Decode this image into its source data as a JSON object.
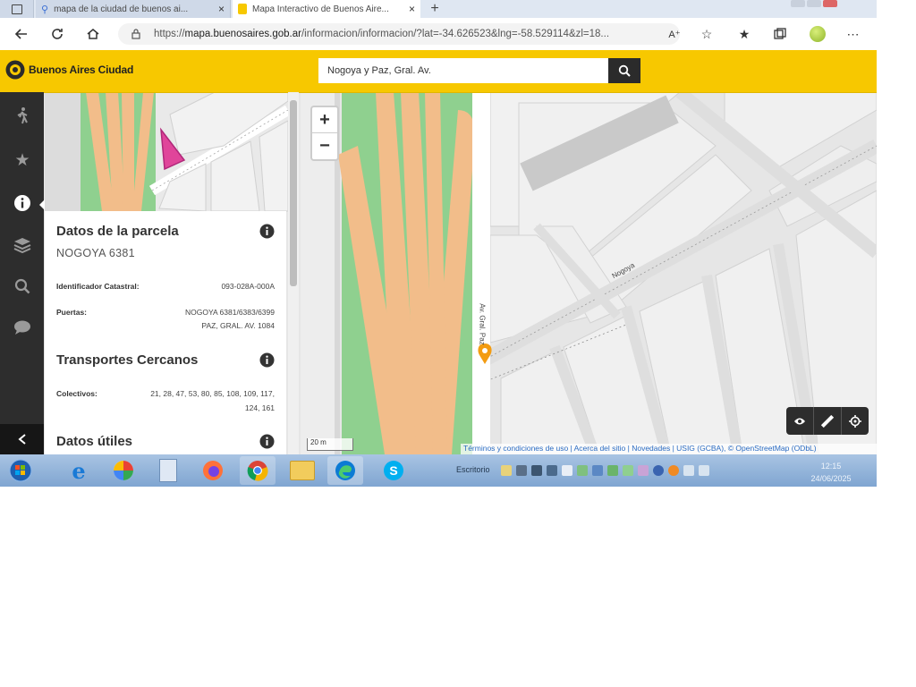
{
  "browser": {
    "tabs": [
      {
        "title": "mapa de la ciudad de buenos ai...",
        "active": false
      },
      {
        "title": "Mapa Interactivo de Buenos Aire...",
        "active": true
      }
    ],
    "url": {
      "prefix": "https://",
      "domain": "mapa.buenosaires.gob.ar",
      "path": "/informacion/informacion/?lat=-34.626523&lng=-58.529114&zl=18..."
    }
  },
  "site": {
    "brand": "Buenos Aires Ciudad",
    "search_value": "Nogoya y Paz, Gral. Av."
  },
  "panel": {
    "parcela": {
      "title": "Datos de la parcela",
      "subtitle": "NOGOYA 6381",
      "id_label": "Identificador Catastral:",
      "id_value": "093-028A-000A",
      "puertas_label": "Puertas:",
      "puertas_line1": "NOGOYA 6381/6383/6399",
      "puertas_line2": "PAZ, GRAL. AV. 1084"
    },
    "transportes": {
      "title": "Transportes Cercanos",
      "colectivos_label": "Colectivos:",
      "colectivos_line1": "21, 28, 47, 53, 80, 85, 108, 109, 117,",
      "colectivos_line2": "124, 161"
    },
    "utiles": {
      "title": "Datos útiles"
    }
  },
  "map": {
    "zoom_in": "+",
    "zoom_out": "−",
    "scale": "20 m",
    "attribution": "Términos y condiciones de uso | Acerca del sitio | Novedades | USIG (GCBA), © OpenStreetMap (ODbL)",
    "street_labels": {
      "nogoya": "Nogoya",
      "paz": "Av. Gral. Paz"
    },
    "colors": {
      "highway": "#f2bd8a",
      "green": "#8cd08e",
      "block": "#f2f2f2",
      "road": "#dcdcdc",
      "accent": "#f7c800",
      "marker": "#f39c12",
      "parcel": "#e0459a"
    }
  },
  "taskbar": {
    "desktop_label": "Escritorio",
    "time": "12:15",
    "date": "24/06/2025"
  }
}
